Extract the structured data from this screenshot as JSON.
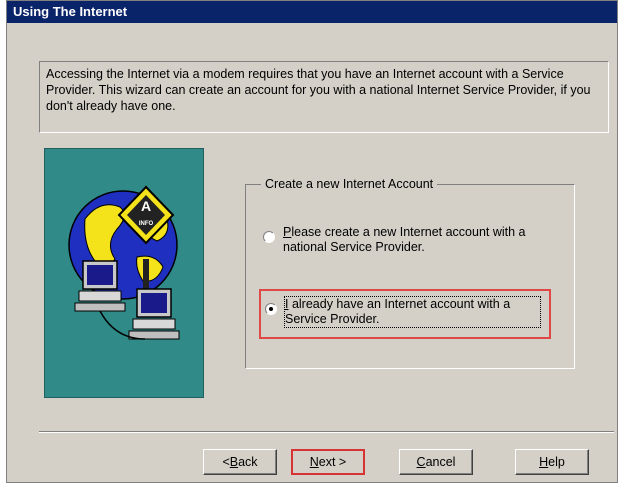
{
  "window": {
    "title": "Using The Internet"
  },
  "description": "Accessing the Internet via a modem requires that you have an Internet account with a Service Provider.  This wizard can create an account for you with a national Internet Service Provider, if you don't already have one.",
  "group": {
    "label": "Create a new Internet Account",
    "options": [
      {
        "accel": "P",
        "rest": "lease create a new Internet account with a national Service Provider.",
        "selected": false
      },
      {
        "accel": "I",
        "rest": " already have an Internet account with a Service Provider.",
        "selected": true
      }
    ]
  },
  "illustration": {
    "sign_text": "INFO"
  },
  "buttons": {
    "back": {
      "prefix": "< ",
      "accel": "B",
      "rest": "ack"
    },
    "next": {
      "accel": "N",
      "rest": "ext >"
    },
    "cancel": {
      "accel": "C",
      "rest": "ancel"
    },
    "help": {
      "accel": "H",
      "rest": "elp"
    }
  },
  "colors": {
    "titlebar": "#0a246a",
    "dialog_bg": "#d4d0c8",
    "art_bg": "#2f8a88",
    "highlight": "#e04848"
  }
}
